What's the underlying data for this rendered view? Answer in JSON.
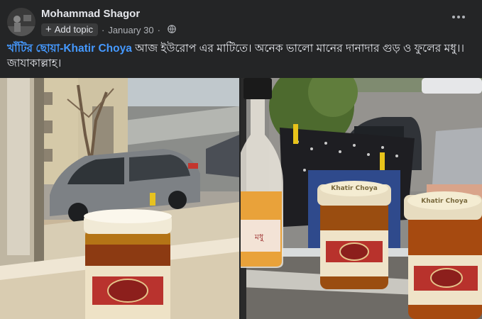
{
  "post": {
    "author": "Mohammad Shagor",
    "add_topic_label": "Add topic",
    "date": "January 30",
    "separator": "·",
    "privacy_icon": "globe-icon",
    "more_icon": "more-horizontal-icon",
    "text": {
      "tag": "খাঁটির ছোয়া-Khatir Choya",
      "body": " আজ ইউরোপ এর মাটিতে। অনেক ভালো মানের দানাদার গুড় ও ফুলের মধু।।জাযাকাল্লাহ।"
    }
  },
  "photos": {
    "left": {
      "jar_lid_text": ""
    },
    "right": {
      "bottle_label": "মধু",
      "jar_lid_text_1": "Khatir Choya",
      "jar_lid_text_2": "Khatir Choya"
    }
  },
  "colors": {
    "background": "#242526",
    "text_primary": "#e4e6eb",
    "text_secondary": "#b0b3b8",
    "link": "#4599ff",
    "chip_bg": "#3a3b3c"
  }
}
